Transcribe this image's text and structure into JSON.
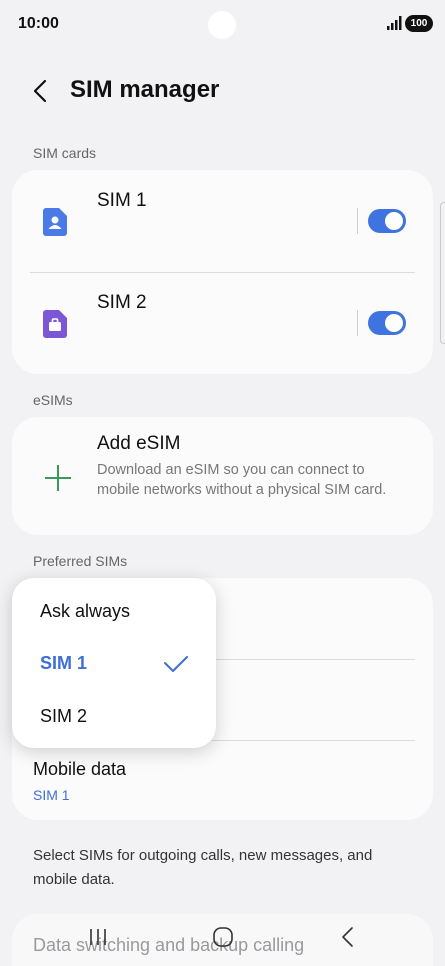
{
  "status_bar": {
    "time": "10:00",
    "battery": "100"
  },
  "header": {
    "title": "SIM manager"
  },
  "sim_cards": {
    "label": "SIM cards",
    "items": [
      {
        "name": "SIM 1",
        "enabled": true,
        "icon": "sim-person-icon",
        "color": "#4a7ae6"
      },
      {
        "name": "SIM 2",
        "enabled": true,
        "icon": "sim-work-icon",
        "color": "#7b57d6"
      }
    ]
  },
  "esims": {
    "label": "eSIMs",
    "add_title": "Add eSIM",
    "add_description": "Download an eSIM so you can connect to mobile networks without a physical SIM card.",
    "icon": "plus-icon"
  },
  "preferred": {
    "label": "Preferred SIMs",
    "mobile_data": {
      "label": "Mobile data",
      "value": "SIM 1"
    }
  },
  "dropdown": {
    "options": [
      "Ask always",
      "SIM 1",
      "SIM 2"
    ],
    "selected": "SIM 1"
  },
  "footnote": "Select SIMs for outgoing calls, new messages, and mobile data.",
  "bottom_item": "Data switching and backup calling",
  "colors": {
    "accent": "#3e73e0",
    "background": "#f2f2f4",
    "card": "#fbfbfc"
  }
}
